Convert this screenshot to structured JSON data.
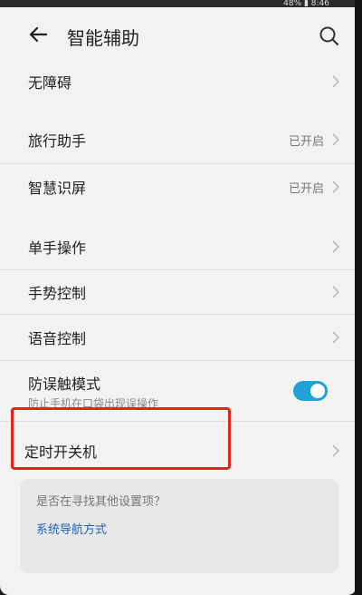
{
  "statusbar": {
    "text": "48% ▮ 8:46"
  },
  "appbar": {
    "title": "智能辅助"
  },
  "rows": [
    {
      "label": "无障碍"
    },
    {
      "label": "旅行助手",
      "value": "已开启"
    },
    {
      "label": "智慧识屏",
      "value": "已开启"
    },
    {
      "label": "单手操作"
    },
    {
      "label": "手势控制"
    },
    {
      "label": "语音控制"
    },
    {
      "label": "防误触模式",
      "subtitle": "防止手机在口袋出现误操作",
      "toggle_on": true
    },
    {
      "label": "定时开关机"
    }
  ],
  "suggestion": {
    "question": "是否在寻找其他设置项？",
    "link": "系统导航方式"
  },
  "colors": {
    "toggle": "#1fa3d6",
    "highlight": "#e0251d",
    "link": "#1f64b5"
  }
}
